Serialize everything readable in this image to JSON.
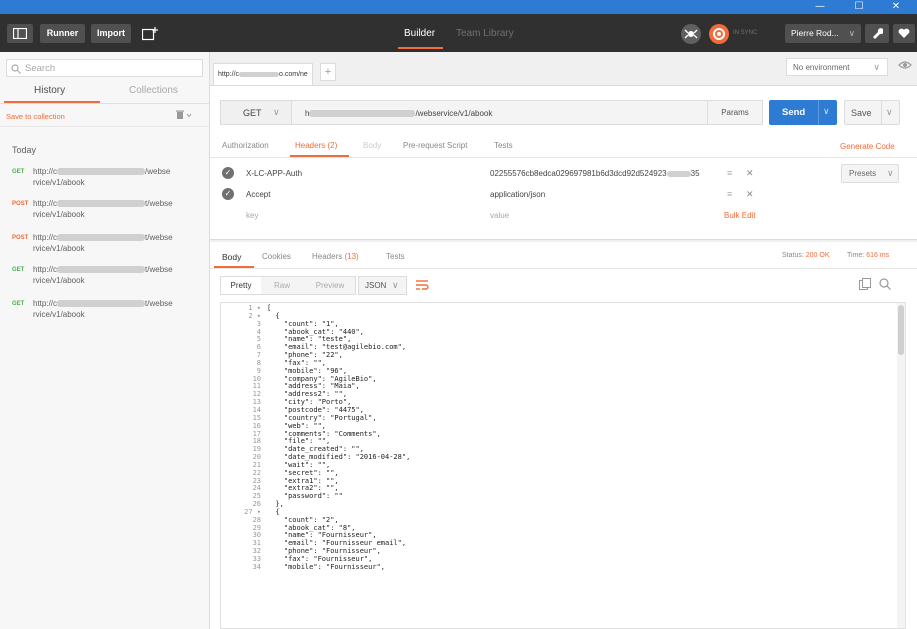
{
  "window": {
    "controls": [
      "—",
      "☐",
      "✕"
    ]
  },
  "toolbar": {
    "runner_label": "Runner",
    "import_label": "Import",
    "tabs": [
      {
        "label": "Builder",
        "active": true
      },
      {
        "label": "Team Library",
        "active": false
      }
    ],
    "sync_status": "IN SYNC",
    "user_name": "Pierre Rod...",
    "accent_color": "#f26b3a"
  },
  "sidebar": {
    "search_placeholder": "Search",
    "tabs": [
      {
        "label": "History",
        "active": true
      },
      {
        "label": "Collections",
        "active": false
      }
    ],
    "save_to_collection": "Save to collection",
    "today_label": "Today",
    "history": [
      {
        "method": "GET",
        "url_start": "http://c",
        "url_end": "/webse",
        "url_line2": "rvice/v1/abook"
      },
      {
        "method": "POST",
        "url_start": "http://c",
        "url_end": "t/webse",
        "url_line2": "rvice/v1/abook"
      },
      {
        "method": "POST",
        "url_start": "http://c",
        "url_end": "t/webse",
        "url_line2": "rvice/v1/abook"
      },
      {
        "method": "GET",
        "url_start": "http://c",
        "url_end": "t/webse",
        "url_line2": "rvice/v1/abook"
      },
      {
        "method": "GET",
        "url_start": "http://c",
        "url_end": "t/webse",
        "url_line2": "rvice/v1/abook"
      }
    ]
  },
  "request_tab": {
    "label_start": "http://c",
    "label_end": "o.com/ne",
    "add_label": "+"
  },
  "environment": {
    "selected": "No environment"
  },
  "request": {
    "method": "GET",
    "url_start": "h",
    "url_end": "/webservice/v1/abook",
    "params_label": "Params",
    "send_label": "Send",
    "save_label": "Save",
    "tabs": [
      {
        "label": "Authorization",
        "active": false
      },
      {
        "label": "Headers (2)",
        "active": true
      },
      {
        "label": "Body",
        "active": false,
        "disabled": true
      },
      {
        "label": "Pre-request Script",
        "active": false
      },
      {
        "label": "Tests",
        "active": false
      }
    ],
    "generate_code": "Generate Code",
    "presets_label": "Presets",
    "headers": [
      {
        "key": "X-LC-APP-Auth",
        "value_start": "02255576cb8edca029697981b6d3dcd92d524923",
        "value_end": "35"
      },
      {
        "key": "Accept",
        "value_start": "application/json",
        "value_end": ""
      }
    ],
    "key_placeholder": "key",
    "value_placeholder": "value",
    "bulk_edit": "Bulk Edit"
  },
  "response": {
    "tabs": [
      {
        "label": "Body",
        "active": true
      },
      {
        "label": "Cookies",
        "active": false
      },
      {
        "label": "Headers",
        "count": "(13)",
        "active": false
      },
      {
        "label": "Tests",
        "active": false
      }
    ],
    "status_label": "Status:",
    "status_value": "200 OK",
    "time_label": "Time:",
    "time_value": "616 ms",
    "view_modes": [
      {
        "label": "Pretty",
        "active": true
      },
      {
        "label": "Raw",
        "active": false
      },
      {
        "label": "Preview",
        "active": false
      }
    ],
    "format": "JSON",
    "line_numbers": [
      "1 ▾",
      "2 ▾",
      "3",
      "4",
      "5",
      "6",
      "7",
      "8",
      "9",
      "10",
      "11",
      "12",
      "13",
      "14",
      "15",
      "16",
      "17",
      "18",
      "19",
      "20",
      "21",
      "22",
      "23",
      "24",
      "25",
      "26",
      "27 ▾",
      "28",
      "29",
      "30",
      "31",
      "32",
      "33",
      "34"
    ],
    "lines": [
      "[",
      "  {",
      "    \"count\": \"1\",",
      "    \"abook_cat\": \"440\",",
      "    \"name\": \"teste\",",
      "    \"email\": \"test@agilebio.com\",",
      "    \"phone\": \"22\",",
      "    \"fax\": \"\",",
      "    \"mobile\": \"96\",",
      "    \"company\": \"AgileBio\",",
      "    \"address\": \"Maia\",",
      "    \"address2\": \"\",",
      "    \"city\": \"Porto\",",
      "    \"postcode\": \"4475\",",
      "    \"country\": \"Portugal\",",
      "    \"web\": \"\",",
      "    \"comments\": \"Comments\",",
      "    \"file\": \"\",",
      "    \"date_created\": \"\",",
      "    \"date_modified\": \"2016-04-28\",",
      "    \"wait\": \"\",",
      "    \"secret\": \"\",",
      "    \"extra1\": \"\",",
      "    \"extra2\": \"\",",
      "    \"password\": \"\"",
      "  },",
      "  {",
      "    \"count\": \"2\",",
      "    \"abook_cat\": \"8\",",
      "    \"name\": \"Fournisseur\",",
      "    \"email\": \"Fournisseur email\",",
      "    \"phone\": \"Fournisseur\",",
      "    \"fax\": \"Fournisseur\",",
      "    \"mobile\": \"Fournisseur\","
    ]
  },
  "icons": {
    "copy": "copy-icon",
    "search": "search-icon",
    "wrap": "wrap-lines-icon"
  }
}
